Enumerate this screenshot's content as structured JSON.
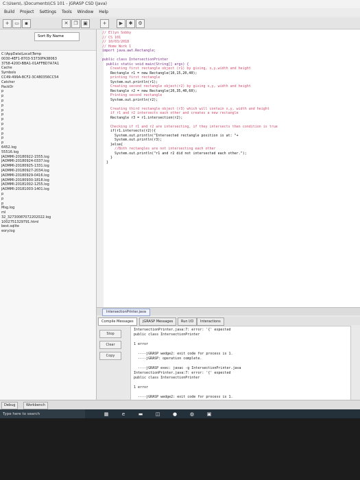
{
  "window": {
    "title": "jGRASP CSD (Java)",
    "path": "C:\\Users\\..\\Documents\\CS 101 - jGRASP CSD (Java)"
  },
  "menu": [
    "Build",
    "Project",
    "Settings",
    "Tools",
    "Window",
    "Help"
  ],
  "sort": {
    "label": "Sort By Name"
  },
  "files": [
    "C:\\AppData\\Local\\Temp",
    "0030-4EF1-8703-53730FA38063",
    "3758-420D-BBA1-01AFFBD7A7A1",
    "Cache",
    "Symbols",
    "CC49-499A-8CF2-3C480356CC54",
    "Catcher",
    "PackOr",
    "p",
    "p",
    "p",
    "p",
    "p",
    "p",
    "p",
    "p",
    "p",
    "p",
    "p",
    "p",
    "6452.log",
    "55516.log",
    "JAOMMI-20180922-1555.log",
    "JAOMMI-20180924-0337.log",
    "JAOMMI-20180925-1331.log",
    "JAOMMI-20180927-2034.log",
    "JAOMMI-20180929-0416.log",
    "JAOMMI-20180930-1818.log",
    "JAOMMI-20181002-1255.log",
    "JAOMMI-20181003-1401.log",
    "p",
    "p",
    "p",
    "Msg.log",
    "ml",
    "32_32730087072202022.log",
    "1002751329791.html",
    "best.sqlite",
    "eory.log"
  ],
  "code_lines": [
    {
      "cls": "c-com",
      "text": "// Ellyn Sobby"
    },
    {
      "cls": "c-com",
      "text": "// CS 101"
    },
    {
      "cls": "c-com",
      "text": "// 10/03/2018"
    },
    {
      "cls": "c-com",
      "text": "// Home Work 1"
    },
    {
      "cls": "c-kw",
      "text": "import java.awt.Rectangle;"
    },
    {
      "cls": "",
      "text": ""
    },
    {
      "cls": "c-kw",
      "text": "public class IntersectionPrinter"
    },
    {
      "cls": "c-kw",
      "text": "  public static void main(String[] args) {"
    },
    {
      "cls": "c-com",
      "text": "    Creating first rectangle object (r1) by giving, x,y,width and height"
    },
    {
      "cls": "",
      "text": "    Rectangle r1 = new Rectangle(10,15,20,40);"
    },
    {
      "cls": "c-com",
      "text": "    printing first rectangle"
    },
    {
      "cls": "",
      "text": "    System.out.println(r1);"
    },
    {
      "cls": "c-com",
      "text": "    Creating second rectangle object(r2) by giving x,y, width and height"
    },
    {
      "cls": "",
      "text": "    Rectangle r2 = new Rectangle(20,35,40,60);"
    },
    {
      "cls": "c-com",
      "text": "    Printing second rectangle"
    },
    {
      "cls": "",
      "text": "    System.out.println(r2);"
    },
    {
      "cls": "",
      "text": ""
    },
    {
      "cls": "c-com",
      "text": "    Creating third rectangle object (r3) which will contain x,y, width and height"
    },
    {
      "cls": "c-com",
      "text": "    if r1 and r2 intersects each other and creates a new rectangle"
    },
    {
      "cls": "",
      "text": "    Rectangle r3 = r1.intersection(r2);"
    },
    {
      "cls": "",
      "text": ""
    },
    {
      "cls": "c-com",
      "text": "    Checking if r1 and r2 are intersecting, if they intersects then condition is true"
    },
    {
      "cls": "",
      "text": "    if(r1.intersects(r2)){"
    },
    {
      "cls": "",
      "text": "      System.out.println(\"Intersected rectangle position is at: \"+"
    },
    {
      "cls": "",
      "text": "      System.out.println(r3);"
    },
    {
      "cls": "",
      "text": "    }else{"
    },
    {
      "cls": "c-com",
      "text": "      //Both rectangles are not intersecting each other"
    },
    {
      "cls": "",
      "text": "      System.out.println(\"r1 and r2 did not intersected each other.\");"
    },
    {
      "cls": "",
      "text": "    }"
    },
    {
      "cls": "",
      "text": "  }"
    }
  ],
  "editor_tab": "IntersectionPrinter.java",
  "msg_tabs": [
    "Compile Messages",
    "jGRASP Messages",
    "Run I/O",
    "Interactions"
  ],
  "side_buttons": {
    "stop": "Stop",
    "clear": "Clear",
    "copy": "Copy"
  },
  "messages": [
    "IntersectionPrinter.java:7: error: '{' expected",
    "public class IntersectionPrinter",
    "",
    "1 error",
    "",
    "  ----jGRASP wedge2: exit code for process is 1.",
    "  ----jGRASP: operation complete.",
    "",
    "  ----jGRASP exec: javac -g IntersectionPrinter.java",
    "IntersectionPrinter.java:7: error: '{' expected",
    "public class IntersectionPrinter",
    "",
    "1 error",
    "",
    "  ----jGRASP wedge2: exit code for process is 1.",
    "  ----jGRASP: operation complete."
  ],
  "bottom_tabs": [
    "Debug",
    "Workbench"
  ],
  "taskbar": {
    "search": "Type here to search"
  }
}
